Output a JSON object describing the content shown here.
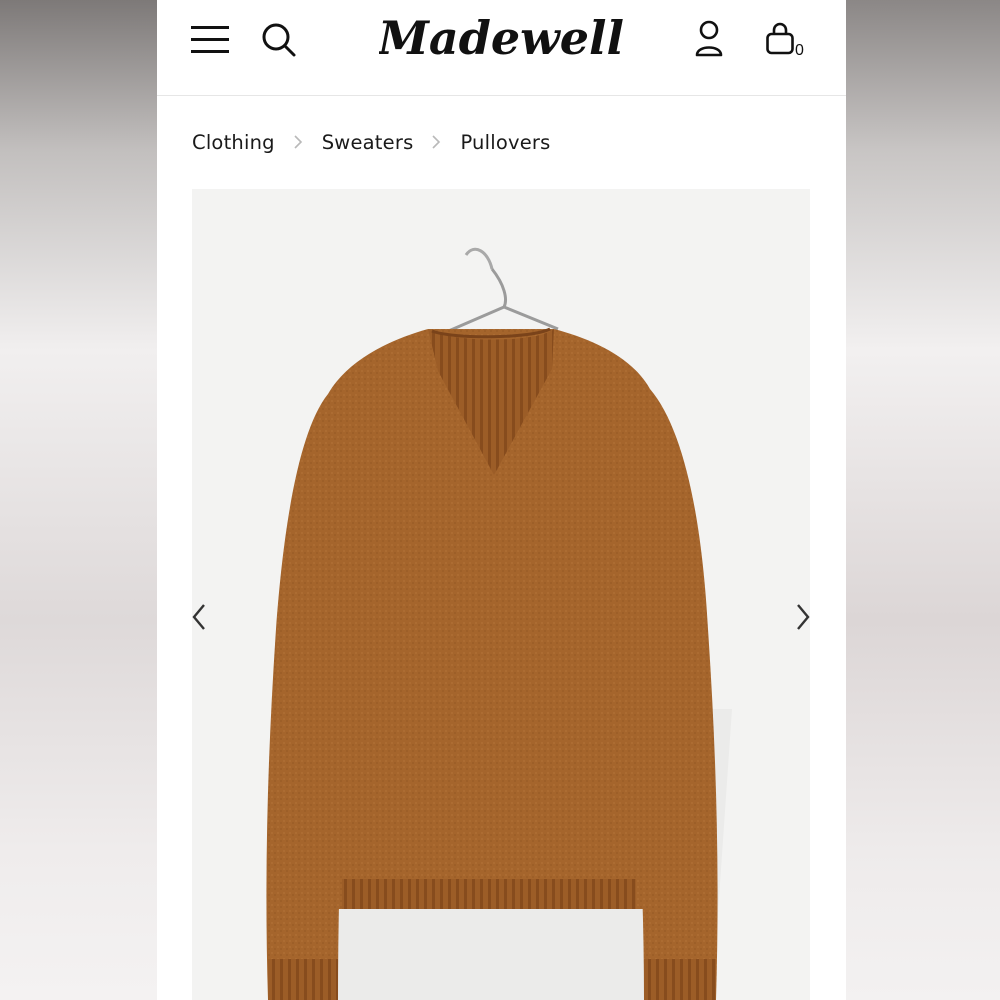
{
  "header": {
    "brand": "Madewell",
    "bag_count": "0",
    "icons": [
      "menu-icon",
      "search-icon",
      "account-icon",
      "bag-icon"
    ]
  },
  "breadcrumb": {
    "items": [
      "Clothing",
      "Sweaters",
      "Pullovers"
    ]
  },
  "gallery": {
    "image": "knit-pullover-sweater-on-hanger",
    "prev_icon": "chevron-left-icon",
    "next_icon": "chevron-right-icon"
  },
  "colors": {
    "sweater": "#a5652c",
    "sweater_dark": "#8a4f1f",
    "gallery_bg": "#f3f3f2",
    "text": "#1a1a1a"
  }
}
